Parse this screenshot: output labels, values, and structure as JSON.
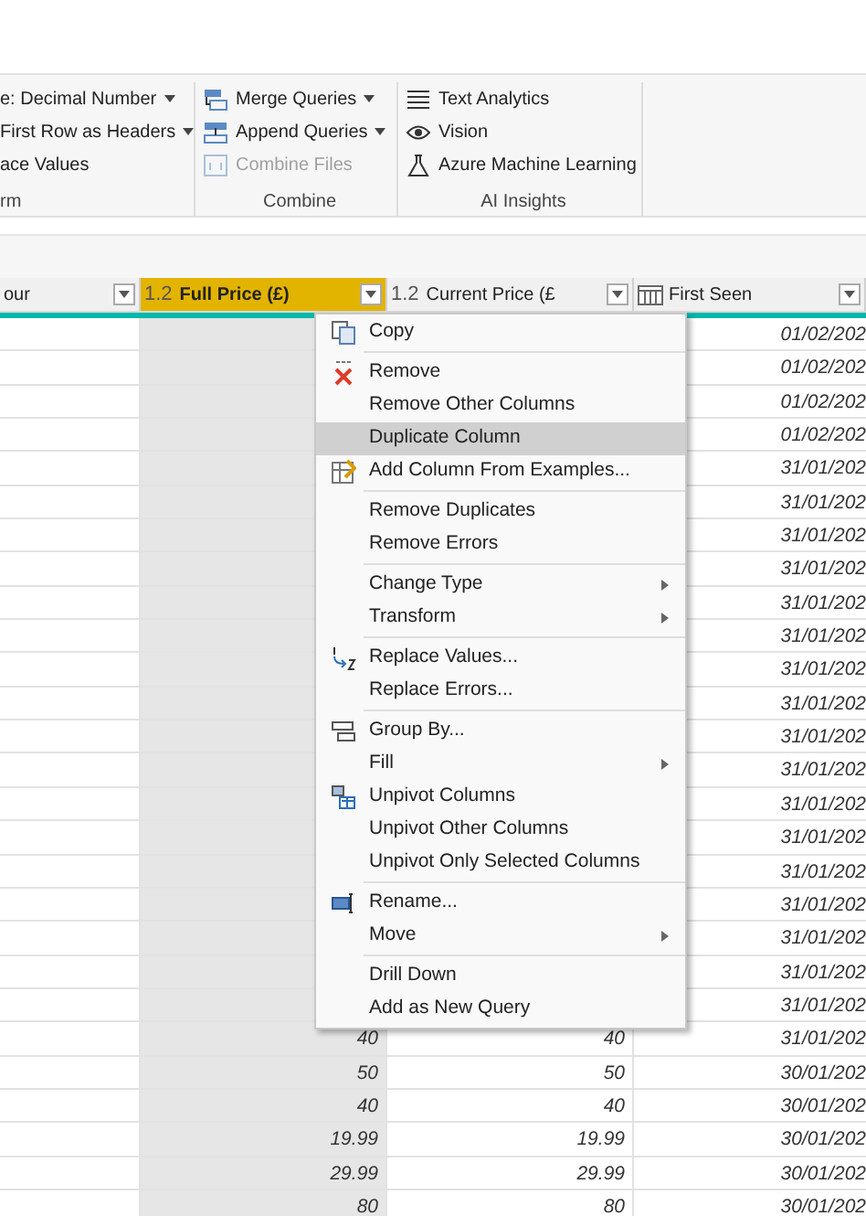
{
  "ribbon": {
    "groups": [
      {
        "label": "rm",
        "items": [
          {
            "label": "e: Decimal Number",
            "dropdown": true,
            "disabled": false
          },
          {
            "label": "First Row as Headers",
            "dropdown": true,
            "disabled": false
          },
          {
            "label": "ace Values",
            "dropdown": false,
            "disabled": false
          }
        ]
      },
      {
        "label": "Combine",
        "items": [
          {
            "label": "Merge Queries",
            "dropdown": true,
            "disabled": false
          },
          {
            "label": "Append Queries",
            "dropdown": true,
            "disabled": false
          },
          {
            "label": "Combine Files",
            "dropdown": false,
            "disabled": true
          }
        ]
      },
      {
        "label": "AI Insights",
        "items": [
          {
            "label": "Text Analytics",
            "dropdown": false,
            "disabled": false
          },
          {
            "label": "Vision",
            "dropdown": false,
            "disabled": false
          },
          {
            "label": "Azure Machine Learning",
            "dropdown": false,
            "disabled": false
          }
        ]
      }
    ]
  },
  "table": {
    "columns": [
      {
        "label": "our",
        "kind": "text",
        "selected": false
      },
      {
        "label": "Full Price (£)",
        "kind": "number",
        "type_label": "1.2",
        "selected": true
      },
      {
        "label": "Current Price (£",
        "kind": "number",
        "type_label": "1.2",
        "selected": false
      },
      {
        "label": "First Seen",
        "kind": "date",
        "selected": false
      }
    ],
    "rows": [
      {
        "first_seen": "01/02/202"
      },
      {
        "first_seen": "01/02/202"
      },
      {
        "first_seen": "01/02/202"
      },
      {
        "first_seen": "01/02/202"
      },
      {
        "first_seen": "31/01/202"
      },
      {
        "first_seen": "31/01/202"
      },
      {
        "first_seen": "31/01/202"
      },
      {
        "first_seen": "31/01/202"
      },
      {
        "first_seen": "31/01/202"
      },
      {
        "first_seen": "31/01/202"
      },
      {
        "first_seen": "31/01/202"
      },
      {
        "first_seen": "31/01/202"
      },
      {
        "first_seen": "31/01/202"
      },
      {
        "first_seen": "31/01/202"
      },
      {
        "first_seen": "31/01/202"
      },
      {
        "first_seen": "31/01/202"
      },
      {
        "first_seen": "31/01/202"
      },
      {
        "first_seen": "31/01/202"
      },
      {
        "first_seen": "31/01/202"
      },
      {
        "first_seen": "31/01/202"
      },
      {
        "first_seen": "31/01/202"
      },
      {
        "full_price": "40",
        "current_price": "40",
        "first_seen": "31/01/202"
      },
      {
        "full_price": "50",
        "current_price": "50",
        "first_seen": "30/01/202"
      },
      {
        "full_price": "40",
        "current_price": "40",
        "first_seen": "30/01/202"
      },
      {
        "full_price": "19.99",
        "current_price": "19.99",
        "first_seen": "30/01/202"
      },
      {
        "full_price": "29.99",
        "current_price": "29.99",
        "first_seen": "30/01/202"
      },
      {
        "full_price": "80",
        "current_price": "80",
        "first_seen": "30/01/202"
      }
    ]
  },
  "context_menu": {
    "groups": [
      [
        {
          "label": "Copy",
          "selected": false,
          "submenu": false
        }
      ],
      [
        {
          "label": "Remove",
          "selected": false,
          "submenu": false
        },
        {
          "label": "Remove Other Columns",
          "selected": false,
          "submenu": false
        },
        {
          "label": "Duplicate Column",
          "selected": true,
          "submenu": false
        },
        {
          "label": "Add Column From Examples...",
          "selected": false,
          "submenu": false
        }
      ],
      [
        {
          "label": "Remove Duplicates",
          "selected": false,
          "submenu": false
        },
        {
          "label": "Remove Errors",
          "selected": false,
          "submenu": false
        }
      ],
      [
        {
          "label": "Change Type",
          "selected": false,
          "submenu": true
        },
        {
          "label": "Transform",
          "selected": false,
          "submenu": true
        }
      ],
      [
        {
          "label": "Replace Values...",
          "selected": false,
          "submenu": false
        },
        {
          "label": "Replace Errors...",
          "selected": false,
          "submenu": false
        }
      ],
      [
        {
          "label": "Group By...",
          "selected": false,
          "submenu": false
        },
        {
          "label": "Fill",
          "selected": false,
          "submenu": true
        },
        {
          "label": "Unpivot Columns",
          "selected": false,
          "submenu": false
        },
        {
          "label": "Unpivot Other Columns",
          "selected": false,
          "submenu": false
        },
        {
          "label": "Unpivot Only Selected Columns",
          "selected": false,
          "submenu": false
        }
      ],
      [
        {
          "label": "Rename...",
          "selected": false,
          "submenu": false
        },
        {
          "label": "Move",
          "selected": false,
          "submenu": true
        }
      ],
      [
        {
          "label": "Drill Down",
          "selected": false,
          "submenu": false
        },
        {
          "label": "Add as New Query",
          "selected": false,
          "submenu": false
        }
      ]
    ]
  }
}
